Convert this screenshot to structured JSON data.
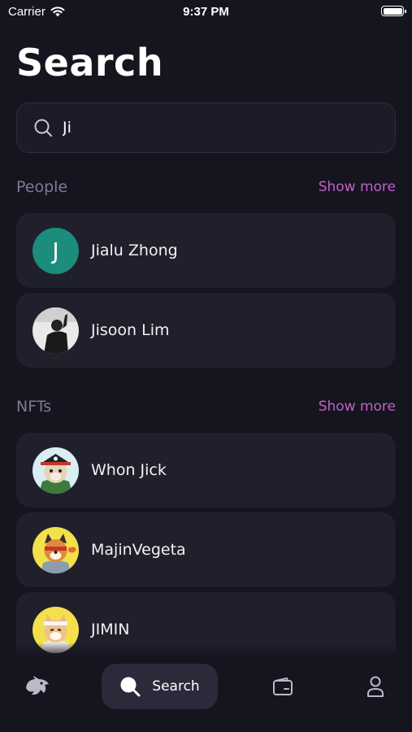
{
  "status_bar": {
    "carrier": "Carrier",
    "time": "9:37 PM"
  },
  "page": {
    "title": "Search"
  },
  "search": {
    "value": "Ji"
  },
  "people": {
    "title": "People",
    "show_more": "Show more",
    "items": [
      {
        "name": "Jialu Zhong",
        "avatar_letter": "J",
        "avatar_color": "#1c8c7c"
      },
      {
        "name": "Jisoon Lim",
        "avatar": "person-photo"
      }
    ]
  },
  "nfts": {
    "title": "NFTs",
    "show_more": "Show more",
    "items": [
      {
        "name": "Whon Jick",
        "avatar": "pirate-dog-nft"
      },
      {
        "name": "MajinVegeta",
        "avatar": "shiba-nft-yellow"
      },
      {
        "name": "JIMIN",
        "avatar": "shiba-nft-bandana"
      }
    ]
  },
  "tab_bar": {
    "items": [
      {
        "icon": "dragon-logo-icon"
      },
      {
        "icon": "search-icon",
        "label": "Search",
        "active": true
      },
      {
        "icon": "wallet-icon"
      },
      {
        "icon": "profile-icon"
      }
    ]
  },
  "colors": {
    "background": "#15151f",
    "card": "#20202c",
    "accent": "#c35fc7",
    "muted": "#7d7a98"
  }
}
